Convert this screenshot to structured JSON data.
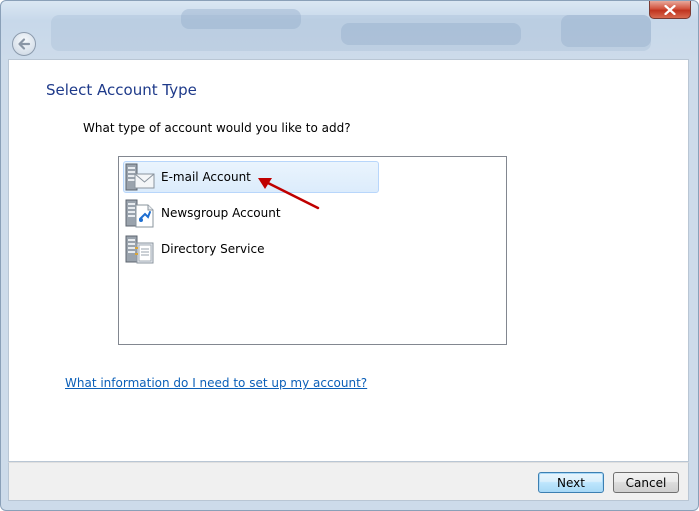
{
  "window": {
    "close_label": "Close",
    "back_label": "Back"
  },
  "page": {
    "title": "Select Account Type",
    "question": "What type of account would you like to add?"
  },
  "account_types": [
    {
      "label": "E-mail Account",
      "icon": "email-server-icon",
      "selected": true
    },
    {
      "label": "Newsgroup Account",
      "icon": "newsgroup-server-icon",
      "selected": false
    },
    {
      "label": "Directory Service",
      "icon": "directory-server-icon",
      "selected": false
    }
  ],
  "help_link": "What information do I need to set up my account?",
  "buttons": {
    "next": "Next",
    "cancel": "Cancel"
  },
  "colors": {
    "title": "#1e3a8a",
    "link": "#0b5fb8",
    "selection": "#dcecfc",
    "annotation_arrow": "#c00000"
  }
}
